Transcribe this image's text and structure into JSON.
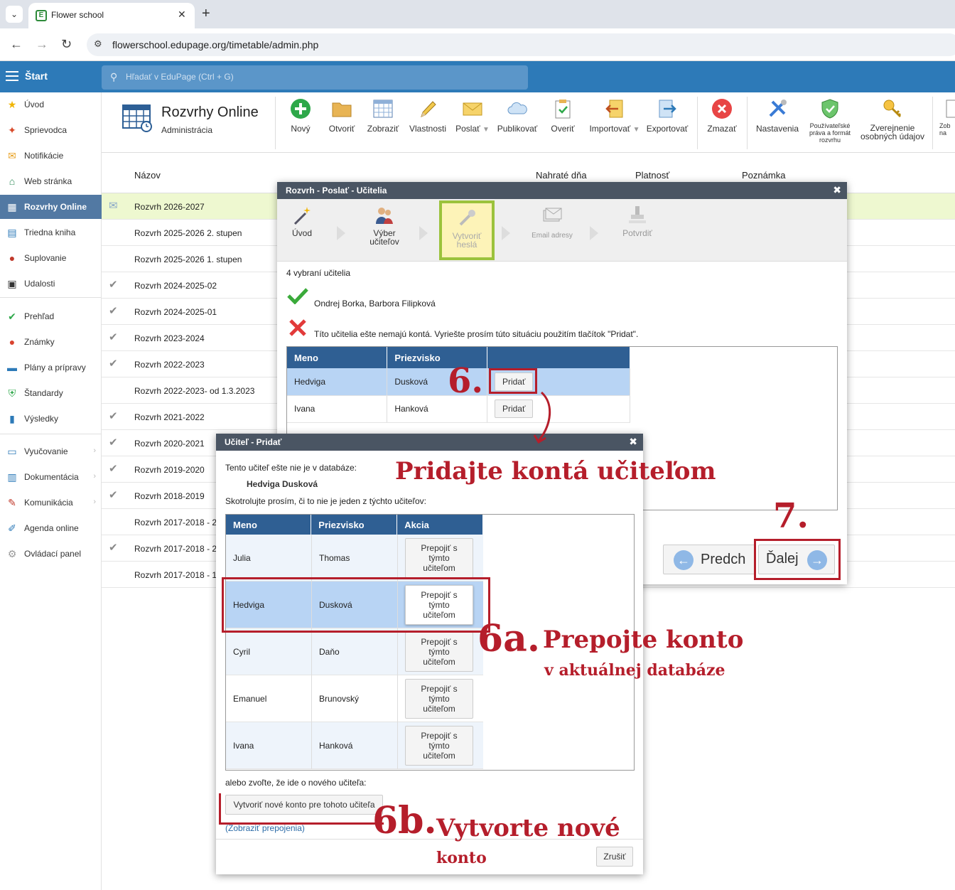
{
  "browser": {
    "tab_title": "Flower school",
    "url": "flowerschool.edupage.org/timetable/admin.php"
  },
  "header": {
    "start": "Štart",
    "search_placeholder": "Hľadať v EduPage (Ctrl + G)"
  },
  "sidebar": {
    "items": [
      {
        "label": "Úvod",
        "icon": "star-icon",
        "color": "#f0b400"
      },
      {
        "label": "Sprievodca",
        "icon": "wand-icon",
        "color": "#d84a2a"
      },
      {
        "label": "Notifikácie",
        "icon": "envelope-icon",
        "color": "#e8a020"
      },
      {
        "label": "Web stránka",
        "icon": "home-icon",
        "color": "#2e8b57"
      },
      {
        "label": "Rozvrhy Online",
        "icon": "grid-icon",
        "color": "#ffffff"
      },
      {
        "label": "Triedna kniha",
        "icon": "book-icon",
        "color": "#2d7ab8"
      },
      {
        "label": "Suplovanie",
        "icon": "user-icon",
        "color": "#c0392b"
      },
      {
        "label": "Udalosti",
        "icon": "calendar-icon",
        "color": "#333333"
      },
      {
        "label": "Prehľad",
        "icon": "check-circle-icon",
        "color": "#2ea84a"
      },
      {
        "label": "Známky",
        "icon": "grade-icon",
        "color": "#d9432f"
      },
      {
        "label": "Plány a prípravy",
        "icon": "briefcase-icon",
        "color": "#2d7ab8"
      },
      {
        "label": "Štandardy",
        "icon": "shield-icon",
        "color": "#2ea84a"
      },
      {
        "label": "Výsledky",
        "icon": "bar-chart-icon",
        "color": "#2d7ab8"
      },
      {
        "label": "Vyučovanie",
        "icon": "open-book-icon",
        "color": "#2d7ab8"
      },
      {
        "label": "Dokumentácia",
        "icon": "document-icon",
        "color": "#2d7ab8"
      },
      {
        "label": "Komunikácia",
        "icon": "chat-icon",
        "color": "#c0392b"
      },
      {
        "label": "Agenda online",
        "icon": "pen-icon",
        "color": "#2d7ab8"
      },
      {
        "label": "Ovládací panel",
        "icon": "gear-icon",
        "color": "#999999"
      }
    ]
  },
  "app": {
    "title": "Rozvrhy Online",
    "subtitle": "Administrácia",
    "toolbar": {
      "novy": "Nový",
      "otvorit": "Otvoriť",
      "zobrazit": "Zobraziť",
      "vlastnosti": "Vlastnosti",
      "poslat": "Poslať",
      "publikovat": "Publikovať",
      "overit": "Overiť",
      "importovat": "Importovať",
      "exportovat": "Exportovať",
      "zmazat": "Zmazať",
      "nastavenia": "Nastavenia",
      "prava_1": "Používateľské",
      "prava_2": "práva a formát",
      "prava_3": "rozvrhu",
      "zverejnenie_1": "Zverejnenie",
      "zverejnenie_2": "osobných údajov",
      "cut_1": "Zob",
      "cut_2": "na"
    }
  },
  "list": {
    "col_nazov": "Názov",
    "col_nahrate": "Nahraté dňa",
    "col_platnost": "Platnosť",
    "col_poznamka": "Poznámka",
    "rows": [
      {
        "name": "Rozvrh 2026-2027"
      },
      {
        "name": "Rozvrh 2025-2026 2. stupen"
      },
      {
        "name": "Rozvrh 2025-2026 1. stupen"
      },
      {
        "name": "Rozvrh 2024-2025-02"
      },
      {
        "name": "Rozvrh 2024-2025-01"
      },
      {
        "name": "Rozvrh 2023-2024"
      },
      {
        "name": "Rozvrh 2022-2023"
      },
      {
        "name": "Rozvrh 2022-2023- od 1.3.2023"
      },
      {
        "name": "Rozvrh 2021-2022"
      },
      {
        "name": "Rozvrh 2020-2021"
      },
      {
        "name": "Rozvrh 2019-2020"
      },
      {
        "name": "Rozvrh 2018-2019"
      },
      {
        "name": "Rozvrh 2017-2018 - 2"
      },
      {
        "name": "Rozvrh 2017-2018 - 2"
      },
      {
        "name": "Rozvrh 2017-2018 - 1"
      }
    ]
  },
  "dialog_send": {
    "title": "Rozvrh - Poslať - Učitelia",
    "steps": {
      "uvod": "Úvod",
      "vyber_1": "Výber",
      "vyber_2": "učiteľov",
      "vytvorit_1": "Vytvoriť",
      "vytvorit_2": "heslá",
      "email": "Email adresy",
      "potvrdit": "Potvrdiť"
    },
    "selected_count": "4 vybraní učitelia",
    "ok_teachers": "Ondrej Borka, Barbora Filipková",
    "missing_msg": "Títo učitelia ešte nemajú kontá. Vyriešte prosím túto situáciu použitím tlačítok \"Pridat\".",
    "col_meno": "Meno",
    "col_priezvisko": "Priezvisko",
    "rows": [
      {
        "meno": "Hedviga",
        "priezvisko": "Dusková",
        "action": "Pridať"
      },
      {
        "meno": "Ivana",
        "priezvisko": "Hanková",
        "action": "Pridať"
      }
    ],
    "prev_label": "Predch",
    "next_label": "Ďalej"
  },
  "dialog_add": {
    "title": "Učiteľ - Pridať",
    "line1": "Tento učiteľ ešte nie je v databáze:",
    "teacher": "Hedviga Dusková",
    "line2": "Skotrolujte prosím, či to nie je jeden z týchto učiteľov:",
    "col_meno": "Meno",
    "col_priezvisko": "Priezvisko",
    "col_akcia": "Akcia",
    "link_btn_1": "Prepojiť s",
    "link_btn_2": "týmto",
    "link_btn_3": "učiteľom",
    "rows": [
      {
        "meno": "Julia",
        "priezvisko": "Thomas"
      },
      {
        "meno": "Hedviga",
        "priezvisko": "Dusková"
      },
      {
        "meno": "Cyril",
        "priezvisko": "Daňo"
      },
      {
        "meno": "Emanuel",
        "priezvisko": "Brunovský"
      },
      {
        "meno": "Ivana",
        "priezvisko": "Hanková"
      }
    ],
    "or_new": "alebo zvoľte, že ide o nového učiteľa:",
    "create_btn": "Vytvoriť nové konto pre tohoto učiteľa",
    "show_links_open": "(",
    "show_links": "Zobraziť prepojenia",
    "show_links_close": ")",
    "cancel": "Zrušiť"
  },
  "annotations": {
    "step6": "6.",
    "step6_text": "Pridajte kontá učiteľom",
    "step7": "7.",
    "step6a": "6a.",
    "step6a_text": "Prepojte konto",
    "step6a_sub": "v aktuálnej databáze",
    "step6b": "6b.",
    "step6b_text": "Vytvorte nové",
    "step6b_sub": "konto",
    "accent": "#b51e2b"
  }
}
